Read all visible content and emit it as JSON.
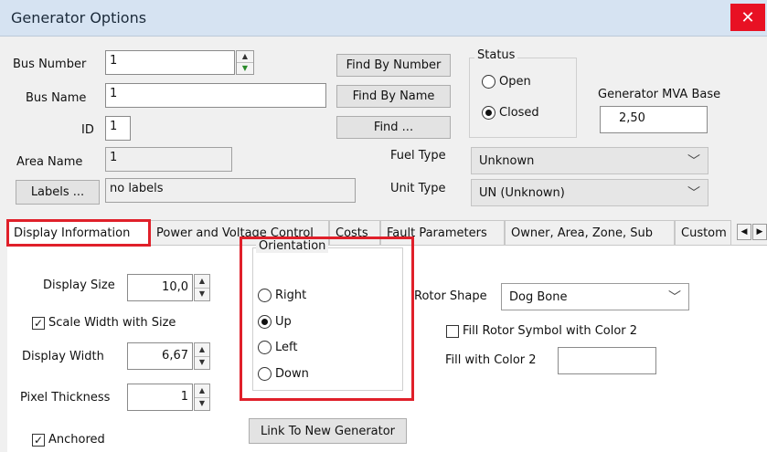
{
  "window": {
    "title": "Generator Options",
    "close_glyph": "✕"
  },
  "bus": {
    "number_label": "Bus Number",
    "number_value": "1",
    "name_label": "Bus Name",
    "name_value": "1",
    "id_label": "ID",
    "id_value": "1",
    "area_label": "Area Name",
    "area_value": "1",
    "labels_button": "Labels ...",
    "labels_value": "no labels"
  },
  "find": {
    "by_number": "Find By Number",
    "by_name": "Find By Name",
    "find": "Find ..."
  },
  "status": {
    "caption": "Status",
    "open": "Open",
    "closed": "Closed",
    "selected": "Closed"
  },
  "mva": {
    "label": "Generator MVA Base",
    "value": "2,50"
  },
  "fuel": {
    "label": "Fuel Type",
    "value": "Unknown"
  },
  "unit": {
    "label": "Unit Type",
    "value": "UN (Unknown)"
  },
  "tabs": [
    {
      "label": "Display Information",
      "active": true
    },
    {
      "label": "Power and Voltage Control"
    },
    {
      "label": "Costs"
    },
    {
      "label": "Fault Parameters"
    },
    {
      "label": "Owner, Area, Zone, Sub"
    },
    {
      "label": "Custom"
    }
  ],
  "display": {
    "size_label": "Display Size",
    "size_value": "10,0",
    "scale_label": "Scale Width with Size",
    "scale_checked": true,
    "width_label": "Display Width",
    "width_value": "6,67",
    "pixel_label": "Pixel Thickness",
    "pixel_value": "1",
    "anchored_label": "Anchored",
    "anchored_checked": true
  },
  "orientation": {
    "caption": "Orientation",
    "options": [
      "Right",
      "Up",
      "Left",
      "Down"
    ],
    "selected": "Up"
  },
  "rotor": {
    "shape_label": "Rotor Shape",
    "shape_value": "Dog Bone",
    "fill_label": "Fill Rotor Symbol with Color 2",
    "fill_checked": false,
    "color2_label": "Fill with Color 2",
    "color2_value": ""
  },
  "link_button": "Link To New Generator",
  "colors": {
    "highlight": "#e0202a",
    "titlebar": "#d6e3f2",
    "close": "#e81123"
  }
}
